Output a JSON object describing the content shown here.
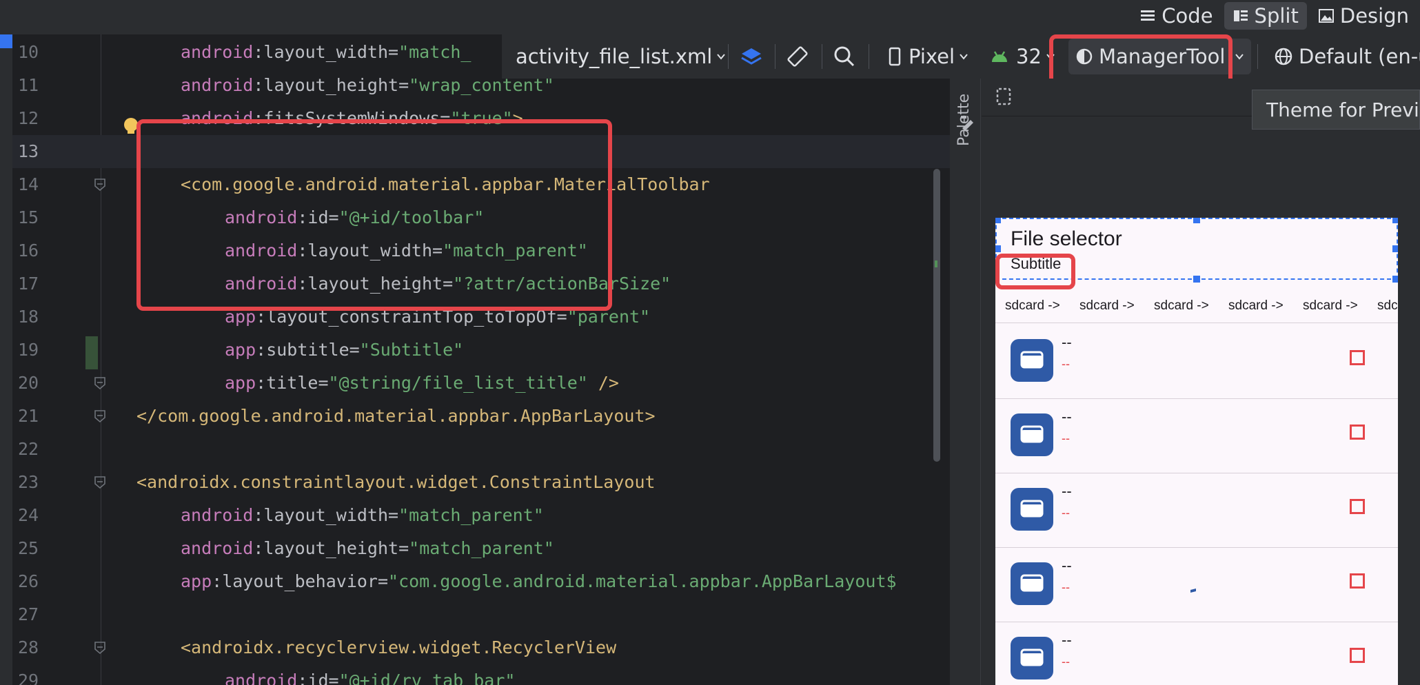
{
  "view_modes": {
    "code": "Code",
    "split": "Split",
    "design": "Design"
  },
  "colors": {
    "highlight": "#e5454a",
    "selection": "#3574f0",
    "folder_icon": "#2f5aa6"
  },
  "editor": {
    "lines": [
      {
        "num": "10",
        "tokens": [
          {
            "t": "android",
            "c": "c-ns"
          },
          {
            "t": ":layout_width=",
            "c": "c-attr"
          },
          {
            "t": "\"match_",
            "c": "c-val"
          }
        ]
      },
      {
        "num": "11",
        "tokens": [
          {
            "t": "android",
            "c": "c-ns"
          },
          {
            "t": ":layout_height=",
            "c": "c-attr"
          },
          {
            "t": "\"wrap_content\"",
            "c": "c-val"
          }
        ]
      },
      {
        "num": "12",
        "tokens": [
          {
            "t": "android",
            "c": "c-ns"
          },
          {
            "t": ":fitsSystemWindows=",
            "c": "c-attr"
          },
          {
            "t": "\"true\"",
            "c": "c-val"
          },
          {
            "t": ">",
            "c": "c-tag"
          }
        ]
      },
      {
        "num": "13",
        "tokens": []
      },
      {
        "num": "14",
        "tokens": [
          {
            "t": "<com.google.android.material.appbar.MaterialToolbar",
            "c": "c-tag"
          }
        ]
      },
      {
        "num": "15",
        "tokens": [
          {
            "t": "android",
            "c": "c-ns"
          },
          {
            "t": ":id=",
            "c": "c-attr"
          },
          {
            "t": "\"@+id/toolbar\"",
            "c": "c-val"
          }
        ]
      },
      {
        "num": "16",
        "tokens": [
          {
            "t": "android",
            "c": "c-ns"
          },
          {
            "t": ":layout_width=",
            "c": "c-attr"
          },
          {
            "t": "\"match_parent\"",
            "c": "c-val"
          }
        ]
      },
      {
        "num": "17",
        "tokens": [
          {
            "t": "android",
            "c": "c-ns"
          },
          {
            "t": ":layout_height=",
            "c": "c-attr"
          },
          {
            "t": "\"?attr/actionBarSize\"",
            "c": "c-val"
          }
        ]
      },
      {
        "num": "18",
        "tokens": [
          {
            "t": "app",
            "c": "c-ns"
          },
          {
            "t": ":layout_constraintTop_toTopOf=",
            "c": "c-attr"
          },
          {
            "t": "\"parent\"",
            "c": "c-val"
          }
        ]
      },
      {
        "num": "19",
        "tokens": [
          {
            "t": "app",
            "c": "c-ns"
          },
          {
            "t": ":subtitle=",
            "c": "c-attr"
          },
          {
            "t": "\"Subtitle\"",
            "c": "c-val"
          }
        ]
      },
      {
        "num": "20",
        "tokens": [
          {
            "t": "app",
            "c": "c-ns"
          },
          {
            "t": ":title=",
            "c": "c-attr"
          },
          {
            "t": "\"@string/file_list_title\"",
            "c": "c-val"
          },
          {
            "t": " />",
            "c": "c-tag"
          }
        ]
      },
      {
        "num": "21",
        "tokens": [
          {
            "t": "</com.google.android.material.appbar.AppBarLayout>",
            "c": "c-tag"
          }
        ]
      },
      {
        "num": "22",
        "tokens": []
      },
      {
        "num": "23",
        "tokens": [
          {
            "t": "<androidx.constraintlayout.widget.ConstraintLayout",
            "c": "c-tag"
          }
        ]
      },
      {
        "num": "24",
        "tokens": [
          {
            "t": "android",
            "c": "c-ns"
          },
          {
            "t": ":layout_width=",
            "c": "c-attr"
          },
          {
            "t": "\"match_parent\"",
            "c": "c-val"
          }
        ]
      },
      {
        "num": "25",
        "tokens": [
          {
            "t": "android",
            "c": "c-ns"
          },
          {
            "t": ":layout_height=",
            "c": "c-attr"
          },
          {
            "t": "\"match_parent\"",
            "c": "c-val"
          }
        ]
      },
      {
        "num": "26",
        "tokens": [
          {
            "t": "app",
            "c": "c-ns"
          },
          {
            "t": ":layout_behavior=",
            "c": "c-attr"
          },
          {
            "t": "\"com.google.android.material.appbar.AppBarLayout$",
            "c": "c-val"
          }
        ]
      },
      {
        "num": "27",
        "tokens": []
      },
      {
        "num": "28",
        "tokens": [
          {
            "t": "<androidx.recyclerview.widget.RecyclerView",
            "c": "c-tag"
          }
        ]
      },
      {
        "num": "29",
        "tokens": [
          {
            "t": "android",
            "c": "c-ns"
          },
          {
            "t": ":id=",
            "c": "c-attr"
          },
          {
            "t": "\"@+id/rv_tab_bar\"",
            "c": "c-val"
          }
        ]
      }
    ]
  },
  "design_toolbar": {
    "file": "activity_file_list.xml",
    "device": "Pixel",
    "api": "32",
    "theme": "ManagerTool",
    "locale": "Default (en-us)"
  },
  "palette_label": "Palette",
  "tooltip": "Theme for Preview",
  "preview": {
    "title": "File selector",
    "subtitle": "Subtitle",
    "tabs": [
      "sdcard ->",
      "sdcard ->",
      "sdcard ->",
      "sdcard ->",
      "sdcard ->",
      "sdcard ->"
    ],
    "rows": [
      {
        "name": "--",
        "size": "--"
      },
      {
        "name": "--",
        "size": "--"
      },
      {
        "name": "--",
        "size": "--"
      },
      {
        "name": "--",
        "size": "--"
      },
      {
        "name": "--",
        "size": "--"
      }
    ]
  }
}
